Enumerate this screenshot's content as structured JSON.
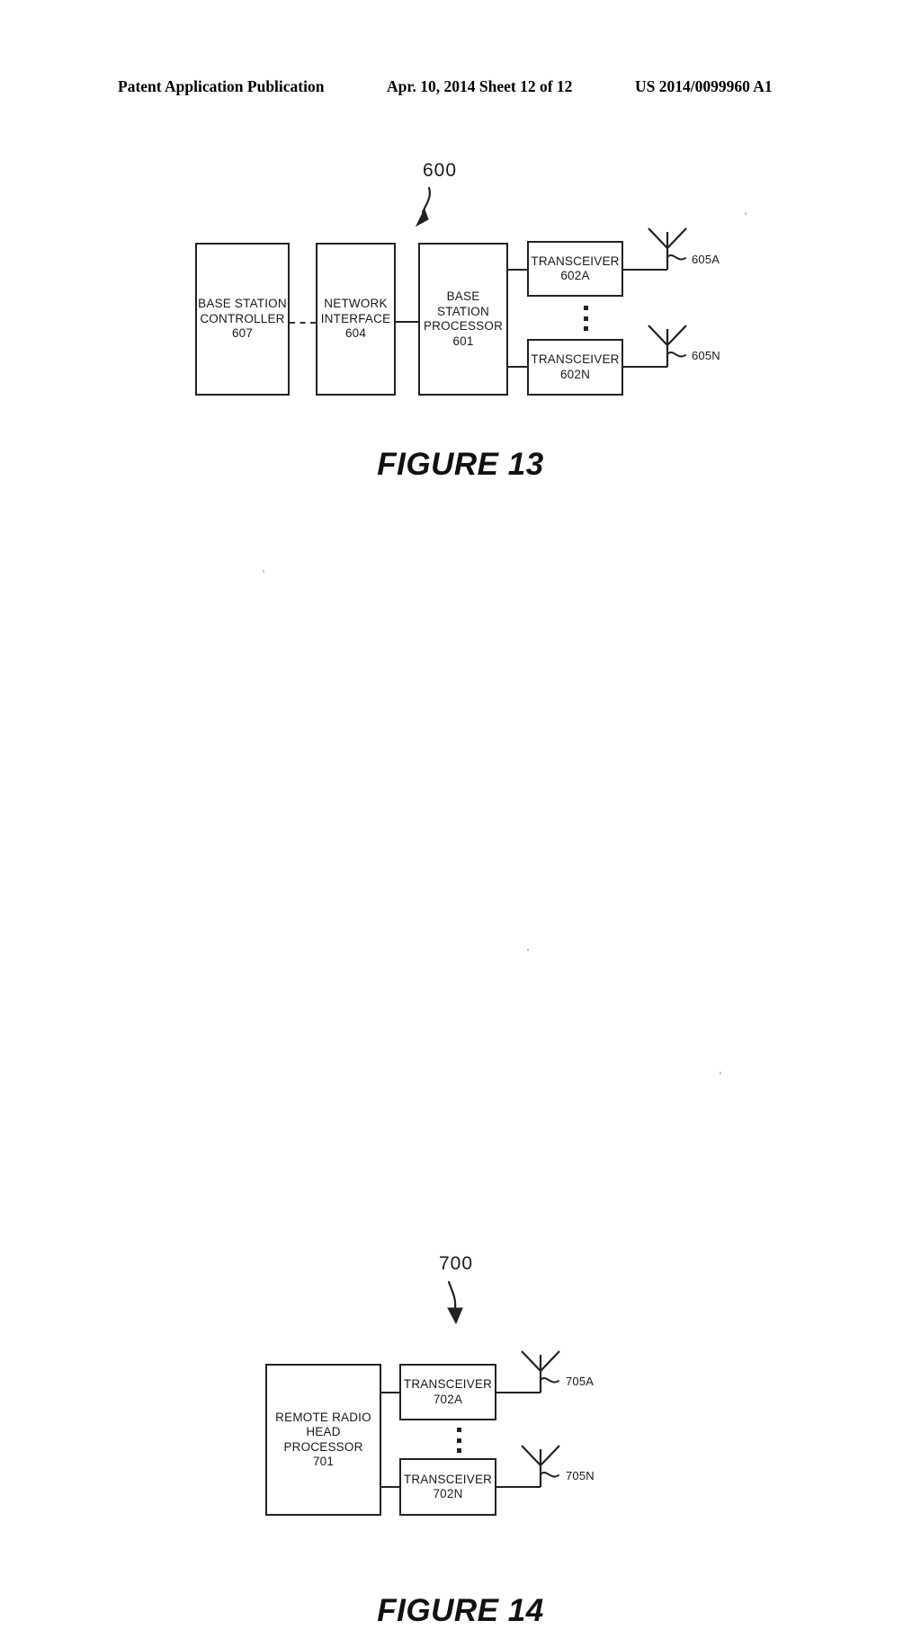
{
  "header": {
    "left": "Patent Application Publication",
    "middle": "Apr. 10, 2014  Sheet 12 of 12",
    "right": "US 2014/0099960 A1"
  },
  "figures": [
    {
      "id": "figure-13",
      "caption": "FIGURE 13",
      "system_ref": "600",
      "nodes": [
        {
          "name": "base-station-controller",
          "lines": [
            "BASE STATION",
            "CONTROLLER",
            "607"
          ],
          "ref": "607"
        },
        {
          "name": "network-interface",
          "lines": [
            "NETWORK",
            "INTERFACE",
            "604"
          ],
          "ref": "604"
        },
        {
          "name": "base-station-processor",
          "lines": [
            "BASE",
            "STATION",
            "PROCESSOR",
            "601"
          ],
          "ref": "601"
        },
        {
          "name": "transceiver-602a",
          "lines": [
            "TRANSCEIVER",
            "602A"
          ],
          "ref": "602A"
        },
        {
          "name": "transceiver-602n",
          "lines": [
            "TRANSCEIVER",
            "602N"
          ],
          "ref": "602N"
        }
      ],
      "antennas": [
        {
          "name": "antenna-605a",
          "label": "605A"
        },
        {
          "name": "antenna-605n",
          "label": "605N"
        }
      ]
    },
    {
      "id": "figure-14",
      "caption": "FIGURE 14",
      "system_ref": "700",
      "nodes": [
        {
          "name": "remote-radio-head-processor",
          "lines": [
            "REMOTE RADIO",
            "HEAD",
            "PROCESSOR",
            "701"
          ],
          "ref": "701"
        },
        {
          "name": "transceiver-702a",
          "lines": [
            "TRANSCEIVER",
            "702A"
          ],
          "ref": "702A"
        },
        {
          "name": "transceiver-702n",
          "lines": [
            "TRANSCEIVER",
            "702N"
          ],
          "ref": "702N"
        }
      ],
      "antennas": [
        {
          "name": "antenna-705a",
          "label": "705A"
        },
        {
          "name": "antenna-705n",
          "label": "705N"
        }
      ]
    }
  ]
}
